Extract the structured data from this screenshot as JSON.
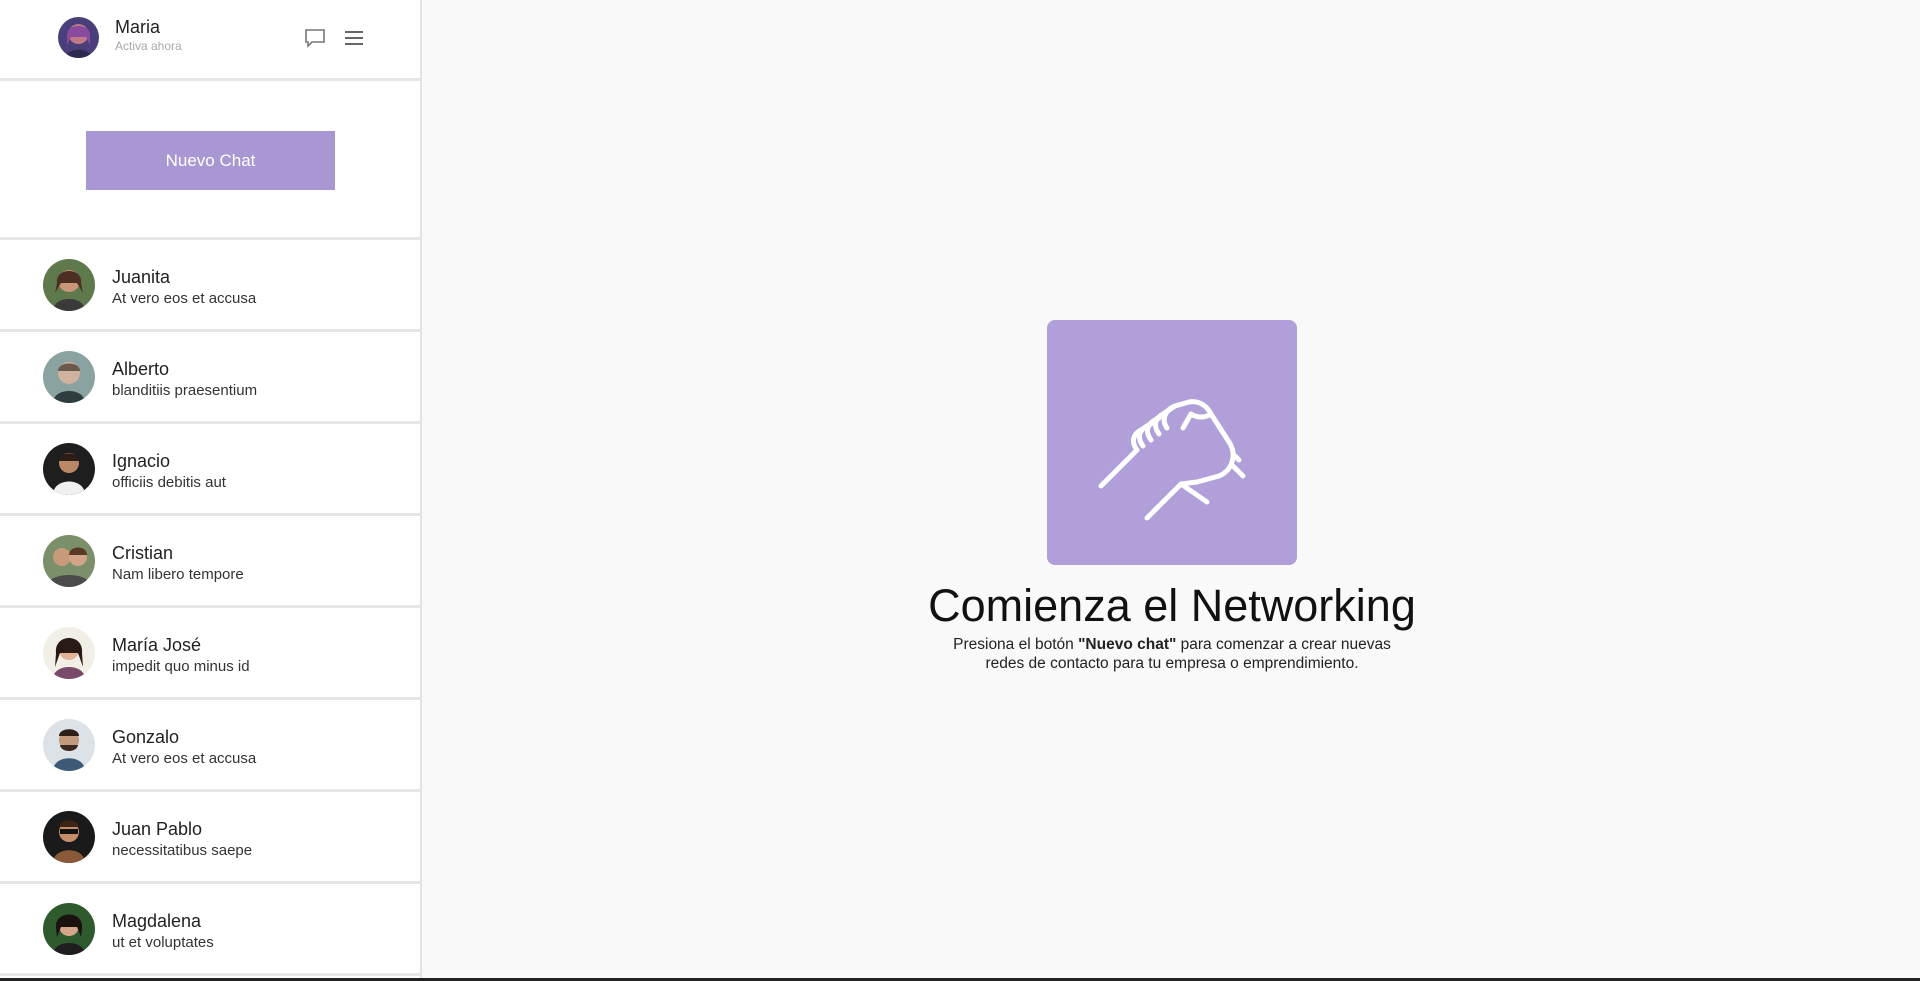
{
  "profile": {
    "name": "Maria",
    "status": "Activa ahora",
    "chat_icon": "chat-bubble-icon",
    "menu_icon": "hamburger-menu-icon"
  },
  "new_chat": {
    "label": "Nuevo Chat"
  },
  "contacts": [
    {
      "name": "Juanita",
      "message": "At vero eos et accusa"
    },
    {
      "name": "Alberto",
      "message": "blanditiis praesentium"
    },
    {
      "name": "Ignacio",
      "message": "officiis debitis aut"
    },
    {
      "name": "Cristian",
      "message": "Nam libero tempore"
    },
    {
      "name": "María José",
      "message": "impedit quo minus id"
    },
    {
      "name": "Gonzalo",
      "message": "At vero eos et accusa"
    },
    {
      "name": "Juan Pablo",
      "message": "necessitatibus saepe"
    },
    {
      "name": "Magdalena",
      "message": "ut et voluptates"
    }
  ],
  "hero": {
    "icon": "handshake-icon",
    "title": "Comienza el Networking",
    "desc_before": "Presiona el botón ",
    "desc_bold": "\"Nuevo chat\"",
    "desc_after": " para comenzar a crear nuevas",
    "desc_line2": "redes de contacto para tu empresa o emprendimiento."
  },
  "colors": {
    "accent": "#a897d3",
    "hero_box": "#b09fd9",
    "background": "#f9f9f9"
  }
}
